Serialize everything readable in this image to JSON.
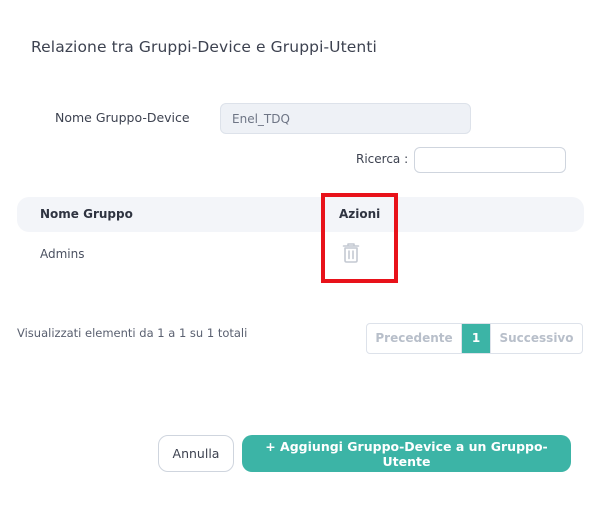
{
  "dialog": {
    "title": "Relazione tra Gruppi-Device e Gruppi-Utenti"
  },
  "form": {
    "device_group_label": "Nome Gruppo-Device",
    "device_group_value": "Enel_TDQ"
  },
  "search": {
    "label": "Ricerca :",
    "value": ""
  },
  "table": {
    "columns": [
      "Nome Gruppo",
      "Azioni"
    ],
    "rows": [
      {
        "name": "Admins",
        "action_icon": "trash-icon"
      }
    ]
  },
  "pagination": {
    "info": "Visualizzati elementi da 1 a 1 su 1 totali",
    "prev_label": "Precedente",
    "current_page": "1",
    "next_label": "Successivo"
  },
  "footer": {
    "cancel_label": "Annulla",
    "add_label": "+ Aggiungi Gruppo-Device a un Gruppo-Utente"
  },
  "colors": {
    "accent": "#3cb4a6",
    "highlight": "#e8121a",
    "header_bg": "#f3f5f9"
  }
}
